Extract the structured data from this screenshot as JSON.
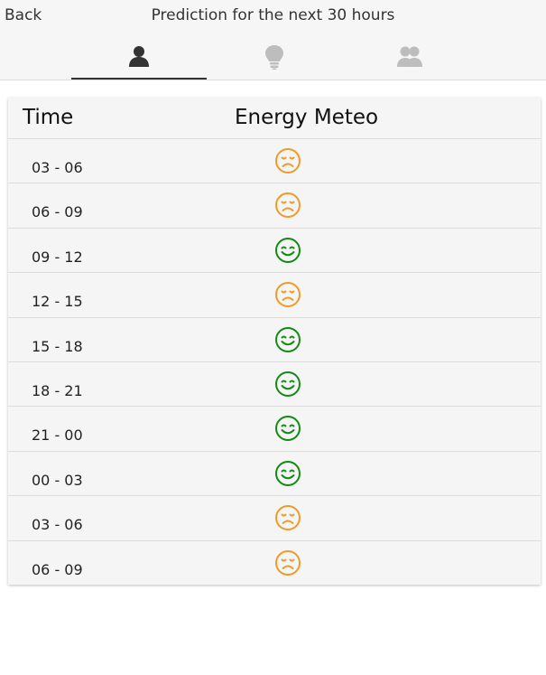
{
  "header": {
    "back_label": "Back",
    "title": "Prediction for the next 30 hours"
  },
  "tabs": [
    {
      "icon": "person-icon",
      "active": true
    },
    {
      "icon": "lightbulb-icon",
      "active": false
    },
    {
      "icon": "group-icon",
      "active": false
    }
  ],
  "table": {
    "columns": [
      "Time",
      "Energy Meteo"
    ],
    "rows": [
      {
        "time": "03 - 06",
        "status": "sad",
        "color": "#f09a28"
      },
      {
        "time": "06 - 09",
        "status": "sad",
        "color": "#f09a28"
      },
      {
        "time": "09 - 12",
        "status": "happy",
        "color": "#138a13"
      },
      {
        "time": "12 - 15",
        "status": "sad",
        "color": "#f09a28"
      },
      {
        "time": "15 - 18",
        "status": "happy",
        "color": "#138a13"
      },
      {
        "time": "18 - 21",
        "status": "happy",
        "color": "#138a13"
      },
      {
        "time": "21 - 00",
        "status": "happy",
        "color": "#138a13"
      },
      {
        "time": "00 - 03",
        "status": "happy",
        "color": "#138a13"
      },
      {
        "time": "03 - 06",
        "status": "sad",
        "color": "#f09a28"
      },
      {
        "time": "06 - 09",
        "status": "sad",
        "color": "#f09a28"
      }
    ]
  }
}
